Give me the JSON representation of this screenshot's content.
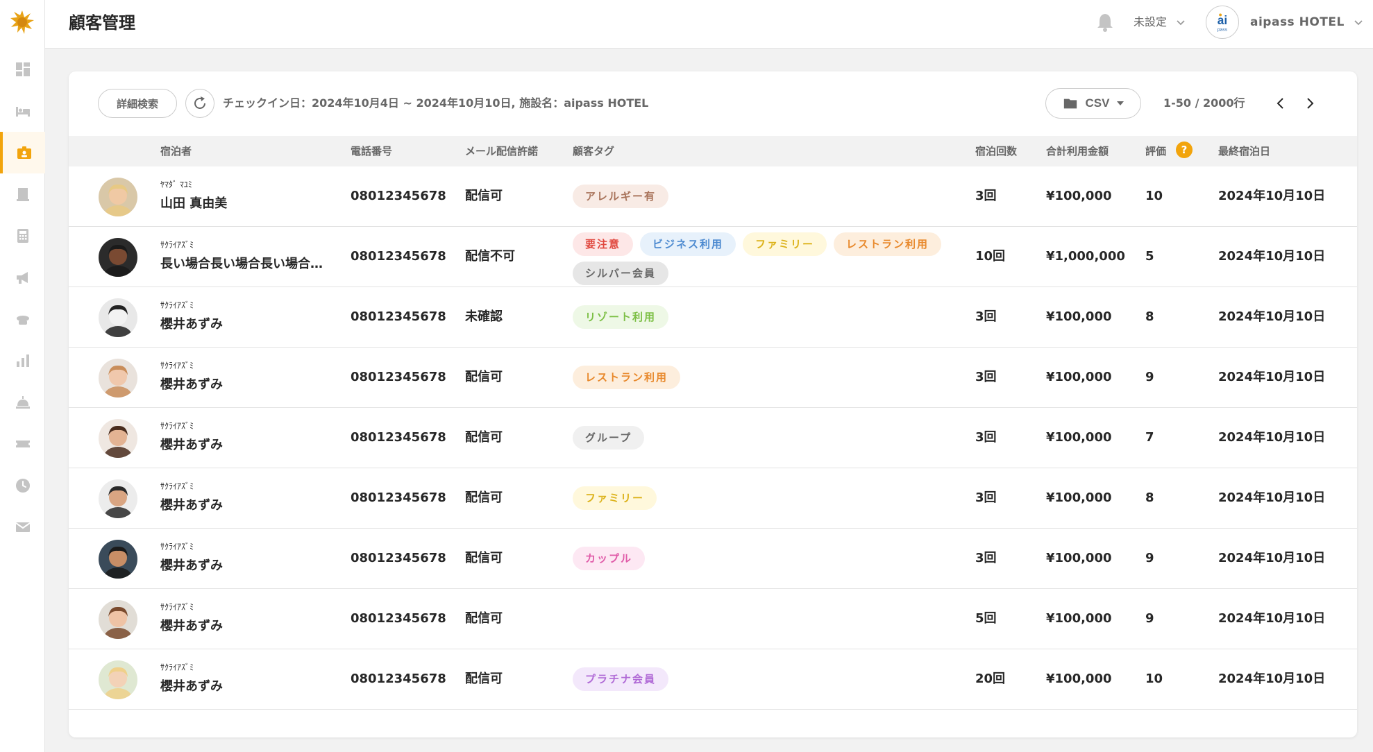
{
  "header": {
    "title": "顧客管理",
    "user_setting": "未設定",
    "hotel_name": "aipass HOTEL"
  },
  "colors": {
    "accent": "#f2a40c",
    "text": "#272727",
    "muted": "#676767"
  },
  "sidebar": {
    "items": [
      {
        "icon": "dashboard-icon"
      },
      {
        "icon": "bed-icon"
      },
      {
        "icon": "customer-icon",
        "active": true
      },
      {
        "icon": "building-icon"
      },
      {
        "icon": "calculator-icon"
      },
      {
        "icon": "megaphone-icon"
      },
      {
        "icon": "cleaning-icon"
      },
      {
        "icon": "bar-chart-icon"
      },
      {
        "icon": "bell-service-icon"
      },
      {
        "icon": "ticket-icon"
      },
      {
        "icon": "clock-icon"
      },
      {
        "icon": "mail-icon"
      }
    ]
  },
  "toolbar": {
    "filter_label": "詳細検索",
    "filter_summary": "チェックイン日：2024年10月4日 ~ 2024年10月10日, 施設名：aipass HOTEL",
    "csv_label": "CSV",
    "pagination": "1-50 / 2000行"
  },
  "table": {
    "columns": {
      "guest": "宿泊者",
      "phone": "電話番号",
      "mail": "メール配信許諾",
      "tags": "顧客タグ",
      "stays": "宿泊回数",
      "amount": "合計利用金額",
      "rating": "評価",
      "rating_help": "?",
      "last_stay": "最終宿泊日"
    },
    "rows": [
      {
        "kana": "ﾔﾏﾀﾞ ﾏﾕﾐ",
        "name": "山田 真由美",
        "phone": "08012345678",
        "mail": "配信可",
        "tags": [
          {
            "label": "アレルギー有",
            "bg": "#f8ebe5",
            "fg": "#a8735a"
          }
        ],
        "stays": "3回",
        "amount": "¥100,000",
        "rating": "10",
        "last_stay": "2024年10月10日"
      },
      {
        "kana": "ｻｸﾗｲｱｽﾞﾐ",
        "name": "長い場合長い場合長い場合長い場合",
        "phone": "08012345678",
        "mail": "配信不可",
        "tags": [
          {
            "label": "要注意",
            "bg": "#fde7e7",
            "fg": "#e0473e"
          },
          {
            "label": "ビジネス利用",
            "bg": "#e7f1fb",
            "fg": "#4d8ad0"
          },
          {
            "label": "ファミリー",
            "bg": "#fff8dc",
            "fg": "#dcb21a"
          },
          {
            "label": "レストラン利用",
            "bg": "#fdeedd",
            "fg": "#e8892c"
          },
          {
            "label": "シルバー会員",
            "bg": "#e6e6e6",
            "fg": "#676767"
          }
        ],
        "stays": "10回",
        "amount": "¥1,000,000",
        "rating": "5",
        "last_stay": "2024年10月10日"
      },
      {
        "kana": "ｻｸﾗｲｱｽﾞﾐ",
        "name": "櫻井あずみ",
        "phone": "08012345678",
        "mail": "未確認",
        "tags": [
          {
            "label": "リゾート利用",
            "bg": "#eef8e6",
            "fg": "#7cbf45"
          }
        ],
        "stays": "3回",
        "amount": "¥100,000",
        "rating": "8",
        "last_stay": "2024年10月10日"
      },
      {
        "kana": "ｻｸﾗｲｱｽﾞﾐ",
        "name": "櫻井あずみ",
        "phone": "08012345678",
        "mail": "配信可",
        "tags": [
          {
            "label": "レストラン利用",
            "bg": "#fdeedd",
            "fg": "#e8892c"
          }
        ],
        "stays": "3回",
        "amount": "¥100,000",
        "rating": "9",
        "last_stay": "2024年10月10日"
      },
      {
        "kana": "ｻｸﾗｲｱｽﾞﾐ",
        "name": "櫻井あずみ",
        "phone": "08012345678",
        "mail": "配信可",
        "tags": [
          {
            "label": "グループ",
            "bg": "#f0f0f0",
            "fg": "#676767"
          }
        ],
        "stays": "3回",
        "amount": "¥100,000",
        "rating": "7",
        "last_stay": "2024年10月10日"
      },
      {
        "kana": "ｻｸﾗｲｱｽﾞﾐ",
        "name": "櫻井あずみ",
        "phone": "08012345678",
        "mail": "配信可",
        "tags": [
          {
            "label": "ファミリー",
            "bg": "#fff8dc",
            "fg": "#dcb21a"
          }
        ],
        "stays": "3回",
        "amount": "¥100,000",
        "rating": "8",
        "last_stay": "2024年10月10日"
      },
      {
        "kana": "ｻｸﾗｲｱｽﾞﾐ",
        "name": "櫻井あずみ",
        "phone": "08012345678",
        "mail": "配信可",
        "tags": [
          {
            "label": "カップル",
            "bg": "#fde8f3",
            "fg": "#e05aa8"
          }
        ],
        "stays": "3回",
        "amount": "¥100,000",
        "rating": "9",
        "last_stay": "2024年10月10日"
      },
      {
        "kana": "ｻｸﾗｲｱｽﾞﾐ",
        "name": "櫻井あずみ",
        "phone": "08012345678",
        "mail": "配信可",
        "tags": [],
        "stays": "5回",
        "amount": "¥100,000",
        "rating": "9",
        "last_stay": "2024年10月10日"
      },
      {
        "kana": "ｻｸﾗｲｱｽﾞﾐ",
        "name": "櫻井あずみ",
        "phone": "08012345678",
        "mail": "配信可",
        "tags": [
          {
            "label": "プラチナ会員",
            "bg": "#f3e8fb",
            "fg": "#b06ad6"
          }
        ],
        "stays": "20回",
        "amount": "¥100,000",
        "rating": "10",
        "last_stay": "2024年10月10日"
      }
    ]
  }
}
